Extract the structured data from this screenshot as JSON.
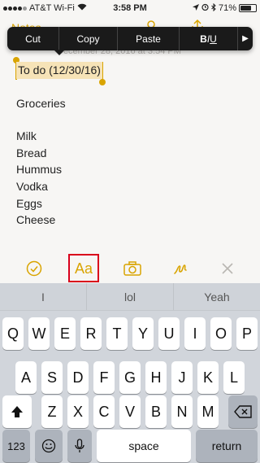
{
  "status_bar": {
    "carrier": "AT&T Wi-Fi",
    "time": "3:58 PM",
    "battery": "71%",
    "battery_level": 0.71
  },
  "nav": {
    "back_label": "Notes"
  },
  "edit_menu": {
    "items": [
      "Cut",
      "Copy",
      "Paste"
    ],
    "format_bold": "B",
    "format_italic": "I",
    "format_underline": "U",
    "more_icon": "play-arrow-icon"
  },
  "note": {
    "timestamp": "December 28, 2016 at 3:54 PM",
    "title": "To do (12/30/16)",
    "heading": "Groceries",
    "items": [
      "Milk",
      "Bread",
      "Hummus",
      "Vodka",
      "Eggs",
      "Cheese"
    ]
  },
  "toolbar": {
    "checklist_icon": "checkmark-circle-icon",
    "format_icon_text": "Aa",
    "camera_icon": "camera-icon",
    "sketch_icon": "sketch-icon",
    "close_icon": "close-icon"
  },
  "keyboard": {
    "suggestions": [
      "I",
      "lol",
      "Yeah"
    ],
    "row1": [
      "Q",
      "W",
      "E",
      "R",
      "T",
      "Y",
      "U",
      "I",
      "O",
      "P"
    ],
    "row2": [
      "A",
      "S",
      "D",
      "F",
      "G",
      "H",
      "J",
      "K",
      "L"
    ],
    "row3": [
      "Z",
      "X",
      "C",
      "V",
      "B",
      "N",
      "M"
    ],
    "numbers_label": "123",
    "space_label": "space",
    "return_label": "return"
  },
  "colors": {
    "accent": "#d9a400",
    "highlight_box": "#d9001b",
    "selection": "#f6e3b7"
  }
}
